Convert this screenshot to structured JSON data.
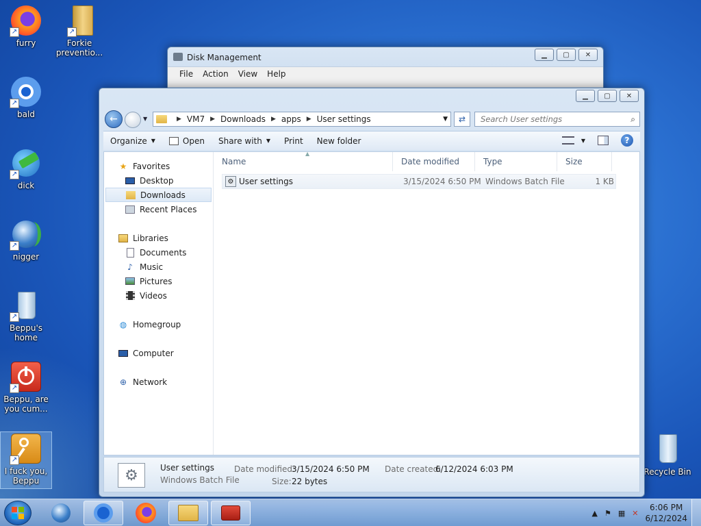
{
  "desktop": {
    "icons": [
      {
        "label": "furry",
        "icon": "firefox-icon"
      },
      {
        "label": "Forkie preventio...",
        "icon": "folder-icon"
      },
      {
        "label": "bald",
        "icon": "chromium-icon"
      },
      {
        "label": "dick",
        "icon": "download-manager-icon"
      },
      {
        "label": "nigger",
        "icon": "globe-icon"
      },
      {
        "label": "Beppu's home",
        "icon": "recycle-bin-icon"
      },
      {
        "label": "Beppu, are you cum...",
        "icon": "power-icon"
      },
      {
        "label": "I fuck you, Beppu",
        "icon": "key-icon"
      },
      {
        "label": "Recycle Bin",
        "icon": "recycle-bin-icon"
      }
    ]
  },
  "disk_management": {
    "title": "Disk Management",
    "menu": [
      "File",
      "Action",
      "View",
      "Help"
    ]
  },
  "explorer": {
    "breadcrumb": [
      "VM7",
      "Downloads",
      "apps",
      "User settings"
    ],
    "search_placeholder": "Search User settings",
    "commands": {
      "organize": "Organize",
      "open": "Open",
      "share_with": "Share with",
      "print": "Print",
      "new_folder": "New folder"
    },
    "nav": {
      "favorites": "Favorites",
      "desktop": "Desktop",
      "downloads": "Downloads",
      "recent_places": "Recent Places",
      "libraries": "Libraries",
      "documents": "Documents",
      "music": "Music",
      "pictures": "Pictures",
      "videos": "Videos",
      "homegroup": "Homegroup",
      "computer": "Computer",
      "network": "Network"
    },
    "columns": {
      "name": "Name",
      "date": "Date modified",
      "type": "Type",
      "size": "Size"
    },
    "files": [
      {
        "name": "User settings",
        "date": "3/15/2024 6:50 PM",
        "type": "Windows Batch File",
        "size": "1 KB"
      }
    ],
    "details": {
      "name": "User settings",
      "type": "Windows Batch File",
      "date_modified_label": "Date modified:",
      "date_modified": "3/15/2024 6:50 PM",
      "size_label": "Size:",
      "size": "22 bytes",
      "date_created_label": "Date created:",
      "date_created": "6/12/2024 6:03 PM"
    }
  },
  "taskbar": {
    "time": "6:06 PM",
    "date": "6/12/2024"
  }
}
